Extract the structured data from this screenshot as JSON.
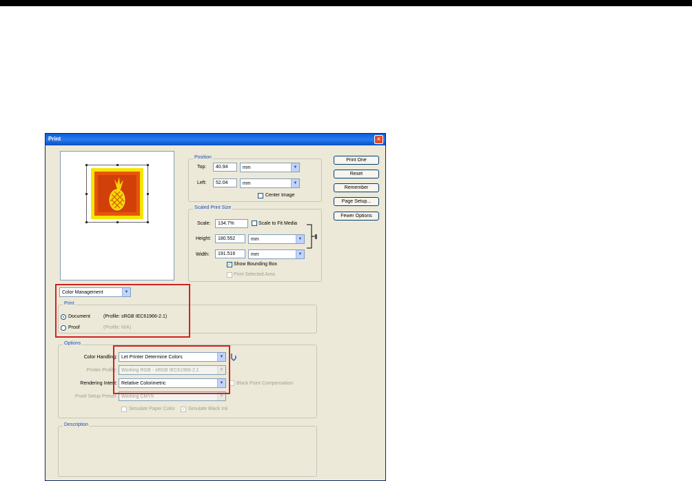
{
  "window": {
    "title": "Print",
    "close_glyph": "×"
  },
  "position": {
    "group_label": "Position",
    "top_label": "Top:",
    "top_value": "40.94",
    "top_unit": "mm",
    "left_label": "Left:",
    "left_value": "52.04",
    "left_unit": "mm",
    "center_image_label": "Center Image"
  },
  "scaled": {
    "group_label": "Scaled Print Size",
    "scale_label": "Scale:",
    "scale_value": "134.7%",
    "scale_to_fit_label": "Scale to Fit Media",
    "height_label": "Height:",
    "height_value": "180.552",
    "height_unit": "mm",
    "width_label": "Width:",
    "width_value": "191.516",
    "width_unit": "mm",
    "show_bounding_box_label": "Show Bounding Box",
    "print_selected_area_label": "Print Selected Area"
  },
  "buttons": {
    "print_one": "Print One",
    "reset": "Reset",
    "remember": "Remember",
    "page_setup": "Page Setup...",
    "fewer_options": "Fewer Options"
  },
  "mode_select": {
    "value": "Color Management"
  },
  "print_group": {
    "label": "Print",
    "document_label": "Document",
    "document_profile": "(Profile: sRGB IEC61966-2.1)",
    "proof_label": "Proof",
    "proof_profile": "(Profile: N/A)"
  },
  "options": {
    "label": "Options",
    "color_handling_label": "Color Handling:",
    "color_handling_value": "Let Printer Determine Colors",
    "printer_profile_label": "Printer Profile:",
    "printer_profile_value": "Working RGB - sRGB IEC61966-2.1",
    "rendering_intent_label": "Rendering Intent:",
    "rendering_intent_value": "Relative Colorimetric",
    "black_point_label": "Black Point Compensation",
    "proof_setup_label": "Proof Setup Preset:",
    "proof_setup_value": "Working CMYK",
    "simulate_paper_label": "Simulate Paper Color",
    "simulate_black_label": "Simulate Black Ink"
  },
  "description": {
    "label": "Description"
  },
  "colors": {
    "highlight": "#d31f1f",
    "titlebar": "#0a5fd8",
    "group_label": "#1c4dbb"
  }
}
